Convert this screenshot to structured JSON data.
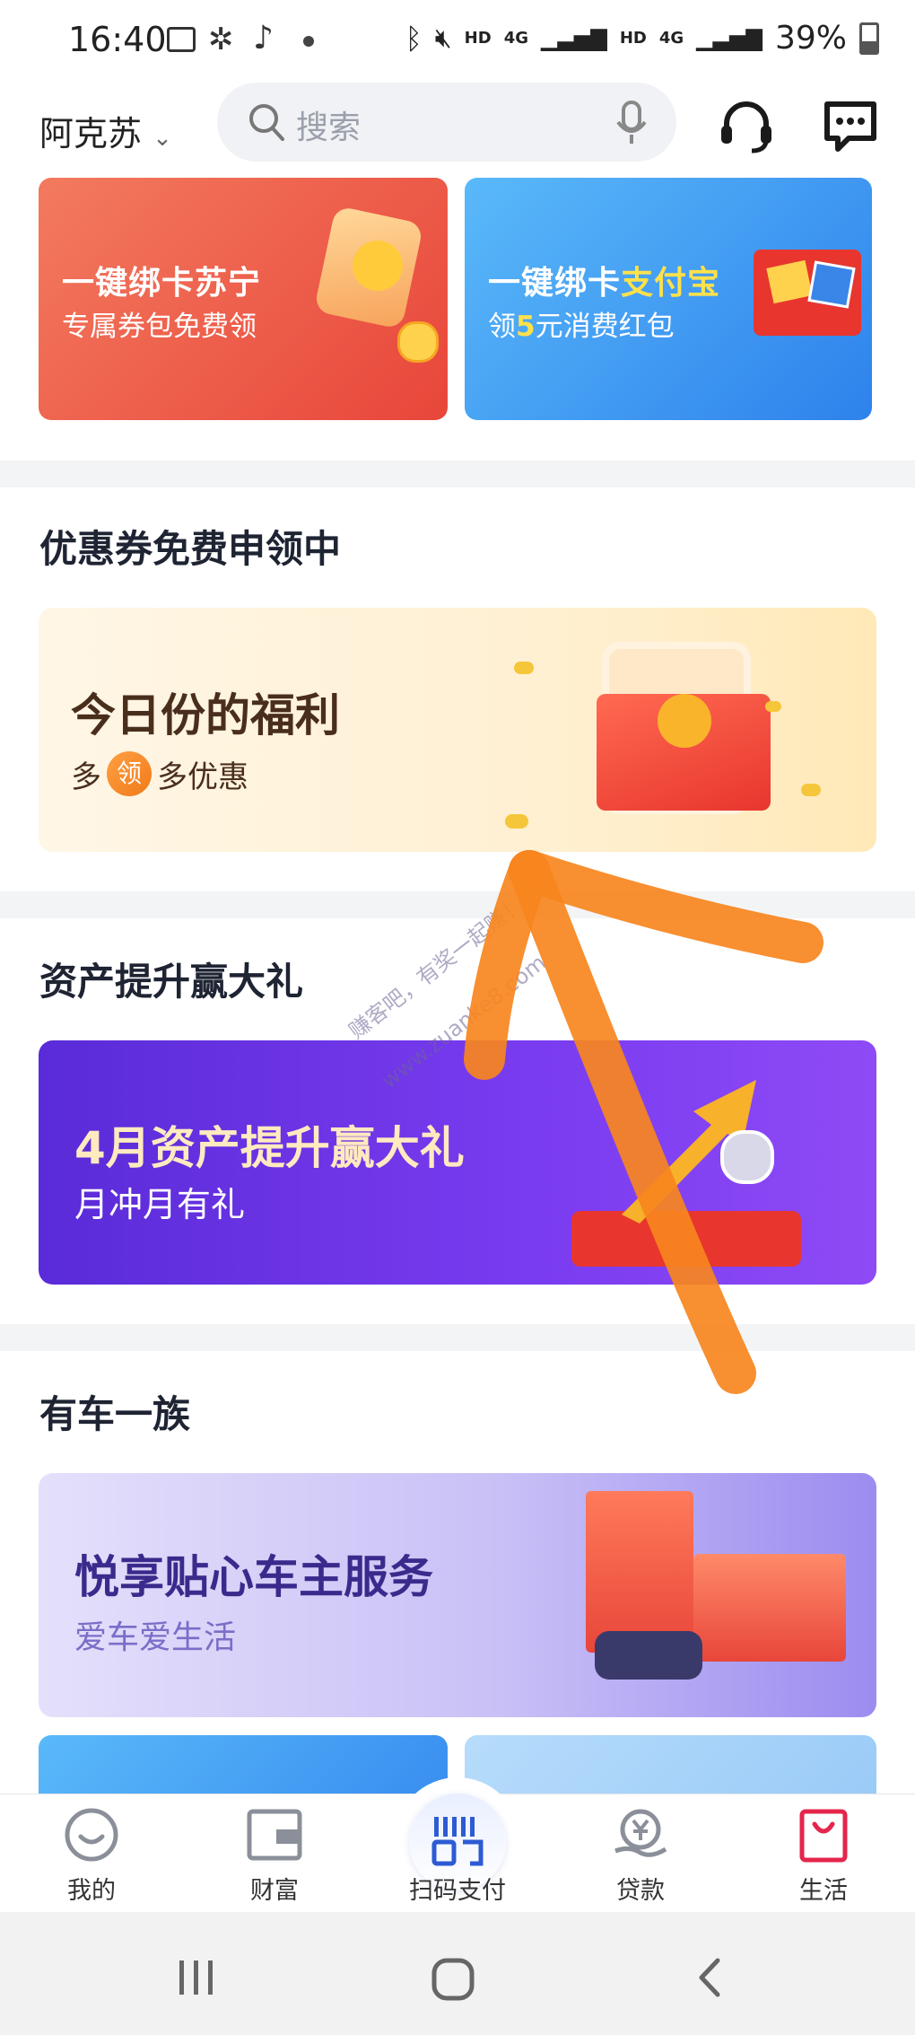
{
  "status_bar": {
    "time": "16:40",
    "battery": "39%",
    "net1": "HD",
    "net2": "4G",
    "net3": "HD",
    "net4": "4G"
  },
  "header": {
    "city": "阿克苏",
    "search_placeholder": "搜索"
  },
  "banners": [
    {
      "title": "一键绑卡苏宁",
      "subtitle": "专属券包免费领",
      "bg_from": "#f06a52",
      "bg_to": "#e8463a"
    },
    {
      "title_a": "一键绑卡",
      "title_b": "支付宝",
      "subtitle_a": "领",
      "subtitle_num": "5",
      "subtitle_b": "元消费红包",
      "bg_from": "#54b6f8",
      "bg_to": "#2f86ee"
    }
  ],
  "section_coupons": {
    "title": "优惠券免费申领中",
    "card": {
      "title": "今日份的福利",
      "sub_a": "多",
      "sub_badge": "领",
      "sub_b": "多优惠"
    }
  },
  "section_assets": {
    "title": "资产提升赢大礼",
    "card": {
      "title": "4月资产提升赢大礼",
      "subtitle": "月冲月有礼",
      "bg_from": "#5a2bd8",
      "bg_to": "#8a45f2"
    },
    "watermark_a": "赚客吧，有奖一起赚！",
    "watermark_b": "www.zuanke8.com"
  },
  "section_car": {
    "title": "有车一族",
    "card": {
      "title": "悦享贴心车主服务",
      "subtitle": "爱车爱生活"
    }
  },
  "bottom_nav": [
    {
      "label": "我的",
      "icon": "smile-icon"
    },
    {
      "label": "财富",
      "icon": "wallet-icon"
    },
    {
      "label": "扫码支付",
      "icon": "qr-scan-icon"
    },
    {
      "label": "贷款",
      "icon": "loan-icon"
    },
    {
      "label": "生活",
      "icon": "shopping-bag-icon"
    }
  ]
}
